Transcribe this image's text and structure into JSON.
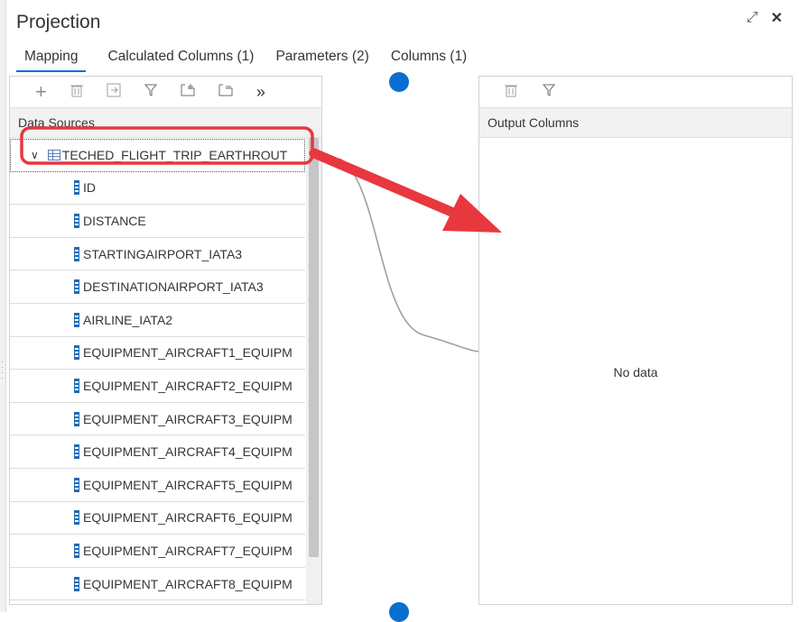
{
  "title": "Projection",
  "header_icons": {
    "expand": "⤢",
    "close": "✕"
  },
  "tabs": [
    {
      "label": "Mapping",
      "active": true
    },
    {
      "label": "Calculated Columns (1)",
      "active": false
    },
    {
      "label": "Parameters (2)",
      "active": false
    },
    {
      "label": "Columns (1)",
      "active": false
    }
  ],
  "left_panel": {
    "toolbar_icons": [
      "add-icon",
      "delete-icon",
      "import-icon",
      "filter-icon",
      "expand-all-icon",
      "collapse-all-icon",
      "more-icon"
    ],
    "header": "Data Sources",
    "root": "TECHED_FLIGHT_TRIP_EARTHROUT",
    "columns": [
      "ID",
      "DISTANCE",
      "STARTINGAIRPORT_IATA3",
      "DESTINATIONAIRPORT_IATA3",
      "AIRLINE_IATA2",
      "EQUIPMENT_AIRCRAFT1_EQUIPM",
      "EQUIPMENT_AIRCRAFT2_EQUIPM",
      "EQUIPMENT_AIRCRAFT3_EQUIPM",
      "EQUIPMENT_AIRCRAFT4_EQUIPM",
      "EQUIPMENT_AIRCRAFT5_EQUIPM",
      "EQUIPMENT_AIRCRAFT6_EQUIPM",
      "EQUIPMENT_AIRCRAFT7_EQUIPM",
      "EQUIPMENT_AIRCRAFT8_EQUIPM"
    ]
  },
  "right_panel": {
    "header": "Output Columns",
    "empty_text": "No data"
  },
  "colors": {
    "accent": "#0a6ed1",
    "annotation": "#e8373f"
  }
}
